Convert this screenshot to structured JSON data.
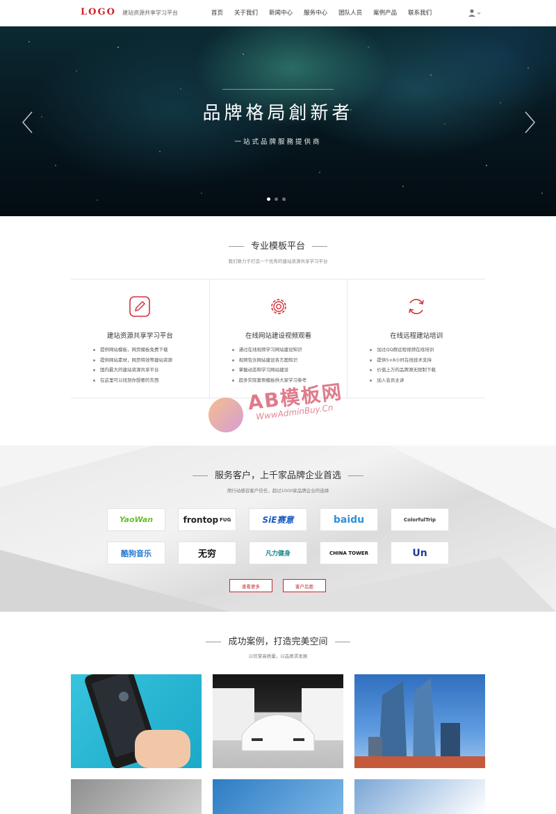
{
  "header": {
    "logo": "LOGO",
    "tagline": "建站资源共享学习平台",
    "nav": [
      "首页",
      "关于我们",
      "新闻中心",
      "服务中心",
      "团队人员",
      "案例产品",
      "联系我们"
    ],
    "user_icon": "user-icon"
  },
  "banner": {
    "title": "品牌格局創新者",
    "subtitle": "一站式品牌服務提供商",
    "prev_icon": "chevron-left-icon",
    "next_icon": "chevron-right-icon",
    "slide_count": 3,
    "active_slide": 1
  },
  "platform": {
    "title": "专业模板平台",
    "subtitle": "我们致力于打造一个优秀的建站资源共享学习平台",
    "features": [
      {
        "icon": "edit-icon",
        "title": "建站资源共享学习平台",
        "items": [
          "提供网站模板，网页模板免费下载",
          "提供网站素材，网页特效等建站资源",
          "国内最大的建站资源共享平台",
          "在这里可以找到你想要的东西"
        ]
      },
      {
        "icon": "gear-icon",
        "title": "在线网站建设视频观看",
        "items": [
          "通过在线视频学习网站建设知识",
          "视频包含网站建设各方面知识",
          "掌握动态和学习网站建设",
          "超多实际案例模板供大家学习参考"
        ]
      },
      {
        "icon": "refresh-icon",
        "title": "在线远程建站培训",
        "items": [
          "加过QQ群远程视频在线培训",
          "提供5×8小时在线技术支持",
          "价值上万的品牌源无限制下载",
          "加入会员主讲"
        ]
      }
    ]
  },
  "watermark": {
    "text": "AB模板网",
    "url": "WwwAdminBuy.Cn",
    "colors": {
      "orange": "#f0a86a",
      "purple": "#c97dc4",
      "red": "#d75a6e"
    }
  },
  "clients": {
    "title": "服务客户，上千家品牌企业首选",
    "subtitle": "用行动感召客户信任，超过1000家品牌企业的选择",
    "logos": [
      {
        "name": "YaoWan",
        "sub": "要玩游戏",
        "color": "#6bbf2a"
      },
      {
        "name": "frontop",
        "sub": "FUG",
        "color": "#222222"
      },
      {
        "name": "SiE赛意",
        "sub": "",
        "color": "#1a5bbf"
      },
      {
        "name": "baidu",
        "sub": "",
        "color": "#2e8fd8"
      },
      {
        "name": "ColorfulTrip",
        "sub": "",
        "color": "#333333"
      },
      {
        "name": "酷狗音乐",
        "sub": "",
        "color": "#1f78d1"
      },
      {
        "name": "无穷",
        "sub": "",
        "color": "#111111"
      },
      {
        "name": "凡力健身",
        "sub": "F.L Fitness",
        "color": "#1d8a8a"
      },
      {
        "name": "CHINA TOWER",
        "sub": "中国铁塔",
        "color": "#111111"
      },
      {
        "name": "Un",
        "sub": "",
        "color": "#1f3b8f"
      }
    ],
    "buttons": {
      "more": "查看更多",
      "add": "客户后面"
    },
    "accent": "#c8242d"
  },
  "cases": {
    "title": "成功案例，打造完美空间",
    "subtitle": "以信誉高质量，以品质求发展"
  }
}
